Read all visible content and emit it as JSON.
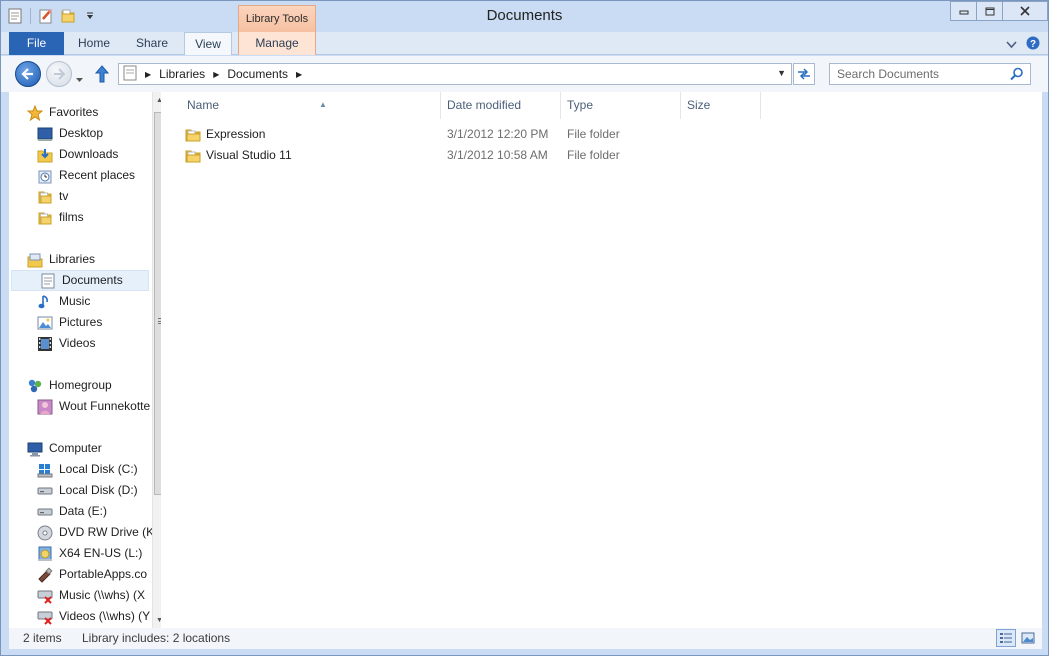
{
  "window": {
    "title": "Documents"
  },
  "quick_access": {
    "icons": [
      "properties-icon",
      "new-folder-icon",
      "folder-icon",
      "customize-dropdown-icon"
    ]
  },
  "ribbon": {
    "contextual_group": "Library Tools",
    "tabs": [
      {
        "label": "File",
        "active": false
      },
      {
        "label": "Home",
        "active": false
      },
      {
        "label": "Share",
        "active": false
      },
      {
        "label": "View",
        "active": true
      },
      {
        "label": "Manage",
        "active": false
      }
    ]
  },
  "address": {
    "crumbs": [
      "Libraries",
      "Documents"
    ],
    "search_placeholder": "Search Documents"
  },
  "nav": {
    "favorites": {
      "label": "Favorites",
      "items": [
        "Desktop",
        "Downloads",
        "Recent places",
        "tv",
        "films"
      ]
    },
    "libraries": {
      "label": "Libraries",
      "items": [
        "Documents",
        "Music",
        "Pictures",
        "Videos"
      ],
      "selected": "Documents"
    },
    "homegroup": {
      "label": "Homegroup",
      "items": [
        "Wout Funnekotte"
      ]
    },
    "computer": {
      "label": "Computer",
      "items": [
        "Local Disk (C:)",
        "Local Disk (D:)",
        "Data (E:)",
        "DVD RW Drive (K",
        "X64 EN-US (L:)",
        "PortableApps.co",
        "Music (\\\\whs) (X",
        "Videos (\\\\whs) (Y"
      ]
    }
  },
  "columns": {
    "name": "Name",
    "date": "Date modified",
    "type": "Type",
    "size": "Size"
  },
  "files": [
    {
      "name": "Expression",
      "date": "3/1/2012 12:20 PM",
      "type": "File folder",
      "size": ""
    },
    {
      "name": "Visual Studio 11",
      "date": "3/1/2012 10:58 AM",
      "type": "File folder",
      "size": ""
    }
  ],
  "status": {
    "count": "2 items",
    "library": "Library includes: 2 locations"
  },
  "colors": {
    "accent": "#2a64b5",
    "context_tab": "#f6bfa0",
    "selection": "#e5f0fb"
  }
}
